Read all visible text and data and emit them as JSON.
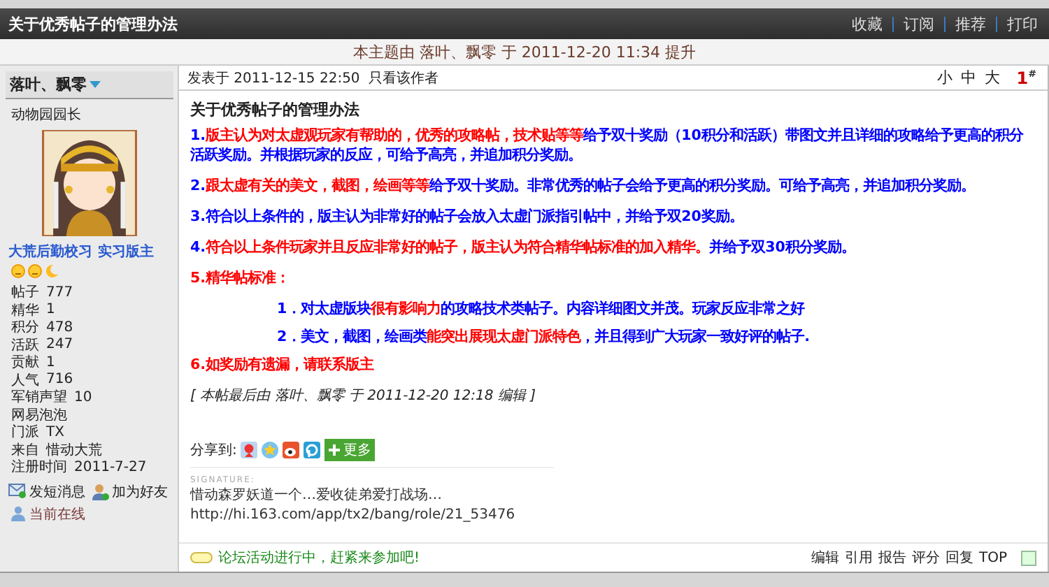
{
  "thread": {
    "title": "关于优秀帖子的管理办法",
    "actions": [
      "收藏",
      "订阅",
      "推荐",
      "打印"
    ],
    "promoted_notice": "本主题由 落叶、飘零 于 2011-12-20 11:34 提升"
  },
  "author": {
    "name": "落叶、飘零",
    "rank": "动物园园长",
    "avatar": {
      "kind": "picture"
    },
    "groups": [
      "大荒后勤校习",
      "实习版主"
    ],
    "stats": [
      {
        "label": "帖子",
        "value": "777"
      },
      {
        "label": "精华",
        "value": "1"
      },
      {
        "label": "积分",
        "value": "478"
      },
      {
        "label": "活跃",
        "value": "247"
      },
      {
        "label": "贡献",
        "value": "1"
      },
      {
        "label": "人气",
        "value": "716"
      },
      {
        "label": "军销声望",
        "value": "10"
      },
      {
        "label": "网易泡泡"
      },
      {
        "label": "门派",
        "value": "TX"
      },
      {
        "label": "来自",
        "value": "惜动大荒"
      },
      {
        "label": "注册时间",
        "value": "2011-7-27"
      }
    ],
    "actions": [
      {
        "kind": "message",
        "label": "发短消息"
      },
      {
        "kind": "friend",
        "label": "加为好友"
      },
      {
        "kind": "online",
        "label": "当前在线"
      }
    ]
  },
  "post": {
    "posted": "发表于 2011-12-15 22:50",
    "only_author": "只看该作者",
    "font_sizes": [
      "小",
      "中",
      "大"
    ],
    "floor": "1",
    "floor_mark": "#",
    "title": "关于优秀帖子的管理办法",
    "paragraphs": [
      {
        "indent": false,
        "segments": [
          {
            "text": "1.",
            "emphasis": false
          },
          {
            "text": "版主认为对太虚观玩家有帮助的，优秀的攻略帖，技术贴等等",
            "emphasis": true
          },
          {
            "text": "给予双十奖励（10积分和活跃）带图文并且详细的攻略给予更高的积分活跃奖励。并根据玩家的反应，可给予高亮，并追加积分奖励。",
            "emphasis": false
          }
        ]
      },
      {
        "indent": false,
        "segments": [
          {
            "text": "2.",
            "emphasis": false
          },
          {
            "text": "跟太虚有关的美文，截图，绘画等等",
            "emphasis": true
          },
          {
            "text": "给予双十奖励。非常优秀的帖子会给予更高的积分奖励。可给予高亮，并追加积分奖励。",
            "emphasis": false
          }
        ]
      },
      {
        "indent": false,
        "segments": [
          {
            "text": "3.符合以上条件的，版主认为非常好的帖子会放入太虚门派指引帖中，并给予双20奖励。",
            "emphasis": false
          }
        ]
      },
      {
        "indent": false,
        "segments": [
          {
            "text": "4.",
            "emphasis": false
          },
          {
            "text": "符合以上条件玩家并且反应非常好的帖子，版主认为符合精华帖标准的加入精华。",
            "emphasis": true
          },
          {
            "text": "并给予双30积分奖励。",
            "emphasis": false
          }
        ]
      },
      {
        "indent": false,
        "segments": [
          {
            "text": "5.精华帖标准：",
            "emphasis": true
          }
        ]
      },
      {
        "indent": true,
        "segments": [
          {
            "text": "1．对太虚版块",
            "emphasis": false
          },
          {
            "text": "很有影响力",
            "emphasis": true
          },
          {
            "text": "的攻略技术类帖子。内容详细图文并茂。玩家反应非常之好",
            "emphasis": false
          }
        ]
      },
      {
        "indent": true,
        "segments": [
          {
            "text": "2．美文，截图，绘画类",
            "emphasis": false
          },
          {
            "text": "能突出展现太虚门派特色",
            "emphasis": true
          },
          {
            "text": "，并且得到广大玩家一致好评的帖子.",
            "emphasis": false
          }
        ]
      },
      {
        "indent": false,
        "segments": [
          {
            "text": "6.如奖励有遗漏，请联系版主",
            "emphasis": true
          }
        ]
      }
    ],
    "edit_note": "[ 本帖最后由 落叶、飘零 于 2011-12-20 12:18 编辑 ]",
    "share_label": "分享到:",
    "share_more": "更多",
    "signature_label": "SIGNATURE:",
    "signature": [
      "惜动森罗妖道一个…爱收徒弟爱打战场…",
      "http://hi.163.com/app/tx2/bang/role/21_53476"
    ],
    "ad_text": "论坛活动进行中，赶紧来参加吧!",
    "footer_actions": [
      "编辑",
      "引用",
      "报告",
      "评分",
      "回复",
      "TOP"
    ],
    "select_checked": false
  }
}
